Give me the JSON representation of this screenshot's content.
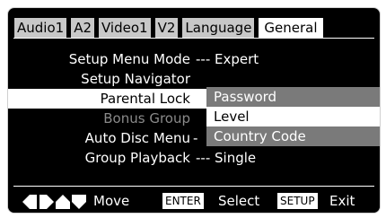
{
  "tabs": [
    "Audio1",
    "A2",
    "Video1",
    "V2",
    "Language",
    "General"
  ],
  "active_tab": "General",
  "menu": [
    {
      "label": "Setup Menu Mode",
      "value": "--- Expert"
    },
    {
      "label": "Setup Navigator",
      "value": ""
    },
    {
      "label": "Parental Lock",
      "value": ""
    },
    {
      "label": "Bonus Group",
      "value": ""
    },
    {
      "label": "Auto Disc Menu",
      "value": "-"
    },
    {
      "label": "Group Playback",
      "value": "--- Single"
    }
  ],
  "popup_options": [
    "Password",
    "Level",
    "Country Code"
  ],
  "popup_current": "Level",
  "footer": {
    "move_label": "Move",
    "enter_key": "ENTER",
    "select_label": "Select",
    "setup_key": "SETUP",
    "exit_label": "Exit"
  },
  "icons": {
    "nav": "direction-arrows-icon"
  }
}
